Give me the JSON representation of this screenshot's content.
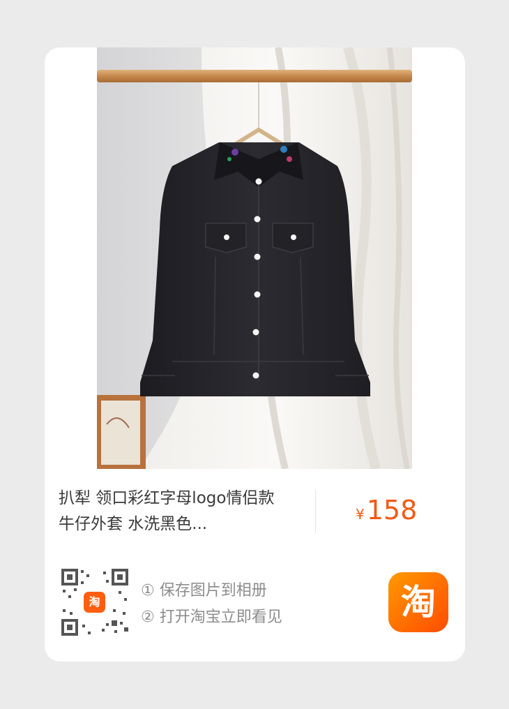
{
  "product": {
    "title": "扒犁 领口彩红字母logo情侣款牛仔外套 水洗黑色...",
    "price_symbol": "¥",
    "price_value": "158"
  },
  "share": {
    "qr_badge": "淘",
    "step1": "① 保存图片到相册",
    "step2": "② 打开淘宝立即看见"
  },
  "app": {
    "logo_text": "淘"
  },
  "colors": {
    "accent": "#f05a17",
    "logo_gradient": "#ff6a00"
  }
}
